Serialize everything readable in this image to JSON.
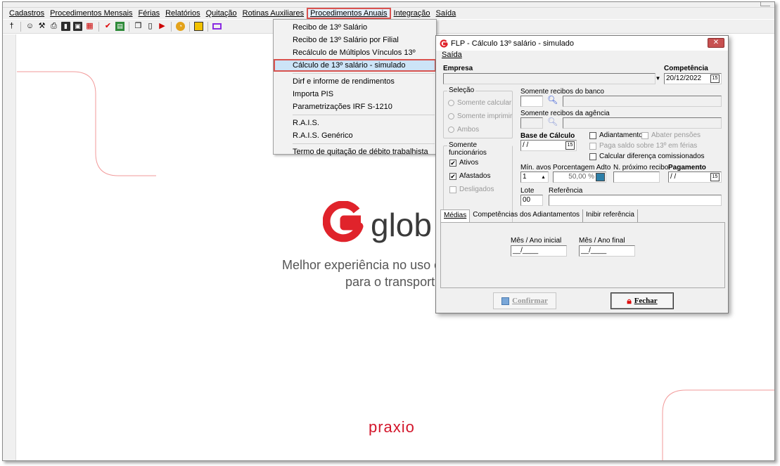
{
  "menubar": {
    "items": [
      "Cadastros",
      "Procedimentos Mensais",
      "Férias",
      "Relatórios",
      "Quitação",
      "Rotinas Auxiliares",
      "Procedimentos Anuais",
      "Integração",
      "Saída"
    ],
    "active_index": 6
  },
  "toolbar": {
    "icons": [
      "pin-icon",
      "users-icon",
      "user-search-icon",
      "printer-icon",
      "book-icon",
      "save-icon",
      "calendar-icon",
      "check-icon",
      "chart-icon",
      "copy-icon",
      "document-icon",
      "export-icon",
      "pie-icon",
      "exit-icon",
      "screen-icon"
    ]
  },
  "dropdown": {
    "items": [
      "Recibo de 13º Salário",
      "Recibo de 13º Salário por Filial",
      "Recálculo de Múltiplos Vínculos 13º",
      "Cálculo de 13º salário - simulado",
      "Dirf e informe de rendimentos",
      "Importa PIS",
      "Parametrizações IRF S-1210",
      "R.A.I.S.",
      "R.A.I.S. Genérico",
      "Termo de quitação de débito trabalhista"
    ],
    "selected_index": 3
  },
  "background": {
    "logo_text": "glob",
    "tagline_line1": "Melhor experiência no uso c",
    "tagline_line2": "para o transport",
    "brand": "praxio",
    "accent": "#e0232b"
  },
  "dialog": {
    "title": "FLP - Cálculo 13º salário - simulado",
    "menu": "Saída",
    "empresa_label": "Empresa",
    "empresa_value": "",
    "competencia_label": "Competência",
    "competencia_value": "20/12/2022",
    "selecao": {
      "title": "Seleção",
      "options": [
        "Somente calcular",
        "Somente imprimir",
        "Ambos"
      ]
    },
    "banco_label": "Somente recibos do banco",
    "agencia_label": "Somente recibos da agência",
    "base_calculo_label": "Base de Cálculo",
    "base_calculo_value": "/ /",
    "adiantamento_label": "Adiantamento",
    "abater_pensoes_label": "Abater pensões",
    "paga_saldo_label": "Paga saldo sobre 13º em férias",
    "calcular_diferenca_label": "Calcular diferença comissionados",
    "funcionarios": {
      "title": "Somente funcionários",
      "ativos": "Ativos",
      "afastados": "Afastados",
      "desligados": "Desligados"
    },
    "min_avos_label": "Mín. avos",
    "min_avos_value": "1",
    "porcentagem_label": "Porcentagem Adto",
    "porcentagem_value": "50,00 %",
    "proximo_recibo_label": "N. próximo recibo",
    "pagamento_label": "Pagamento",
    "pagamento_value": "/ /",
    "lote_label": "Lote",
    "lote_value": "00",
    "referencia_label": "Referência",
    "tabs": [
      "Médias",
      "Competências dos Adiantamentos",
      "Inibir referência"
    ],
    "mes_ano_inicial_label": "Mês / Ano inicial",
    "mes_ano_inicial_value": "__/____",
    "mes_ano_final_label": "Mês / Ano final",
    "mes_ano_final_value": "__/____",
    "confirmar_label": "Confirmar",
    "fechar_label": "Fechar"
  }
}
